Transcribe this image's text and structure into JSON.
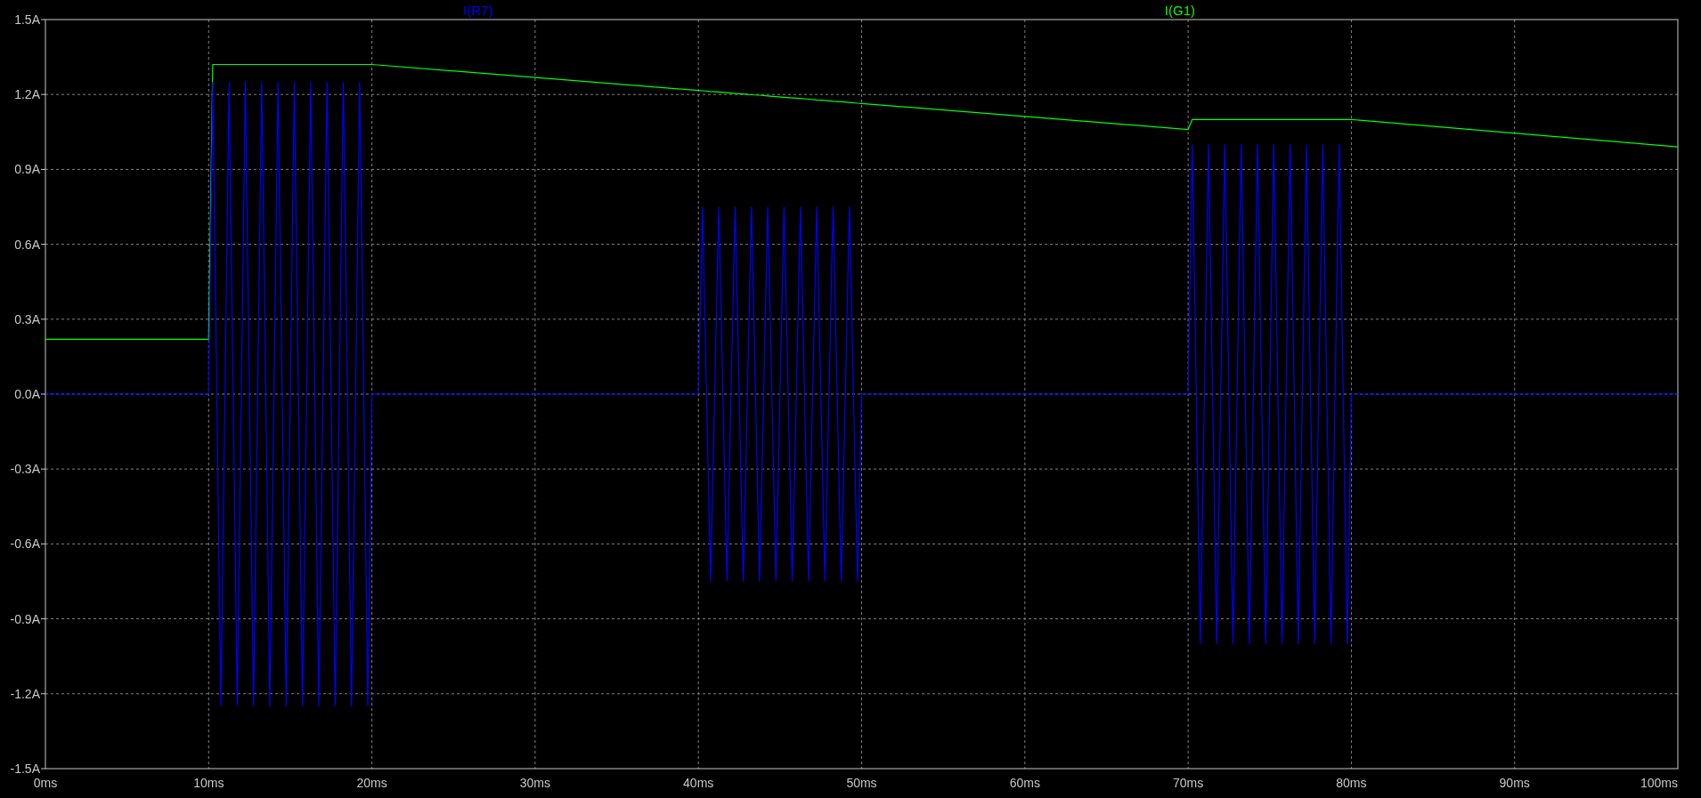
{
  "plot": {
    "chart_data": {
      "type": "line",
      "x": [
        0,
        10,
        10.25,
        10.75,
        11.25,
        11.75,
        12.25,
        12.75,
        13.25,
        13.75,
        14.25,
        14.75,
        15.25,
        15.75,
        16.25,
        16.75,
        17.25,
        17.75,
        18.25,
        18.75,
        19.25,
        19.75,
        20,
        40,
        40.25,
        40.75,
        41.25,
        41.75,
        42.25,
        42.75,
        43.25,
        43.75,
        44.25,
        44.75,
        45.25,
        45.75,
        46.25,
        46.75,
        47.25,
        47.75,
        48.25,
        48.75,
        49.25,
        49.75,
        50,
        70,
        70.25,
        70.75,
        71.25,
        71.75,
        72.25,
        72.75,
        73.25,
        73.75,
        74.25,
        74.75,
        75.25,
        75.75,
        76.25,
        76.75,
        77.25,
        77.75,
        78.25,
        78.75,
        79.25,
        79.75,
        80,
        100
      ],
      "series": [
        {
          "name": "I(R7)",
          "color": "#0000ff",
          "values": [
            0,
            0,
            1.25,
            -1.25,
            1.25,
            -1.25,
            1.25,
            -1.25,
            1.25,
            -1.25,
            1.25,
            -1.25,
            1.25,
            -1.25,
            1.25,
            -1.25,
            1.25,
            -1.25,
            1.25,
            -1.25,
            1.25,
            -1.25,
            0,
            0,
            0.75,
            -0.75,
            0.75,
            -0.75,
            0.75,
            -0.75,
            0.75,
            -0.75,
            0.75,
            -0.75,
            0.75,
            -0.75,
            0.75,
            -0.75,
            0.75,
            -0.75,
            0.75,
            -0.75,
            0.75,
            -0.75,
            0,
            0,
            1,
            -1,
            1,
            -1,
            1,
            -1,
            1,
            -1,
            1,
            -1,
            1,
            -1,
            1,
            -1,
            1,
            -1,
            1,
            -1,
            1,
            -1,
            0,
            0
          ]
        },
        {
          "name": "I(G1)",
          "color": "#00ff00",
          "values": [
            0.22,
            0.22,
            1.32,
            1.32,
            1.32,
            1.32,
            1.32,
            1.32,
            1.32,
            1.32,
            1.32,
            1.32,
            1.32,
            1.32,
            1.32,
            1.32,
            1.32,
            1.32,
            1.32,
            1.32,
            1.32,
            1.32,
            1.32,
            1.216,
            1.215,
            1.212,
            1.21,
            1.207,
            1.204,
            1.202,
            1.199,
            1.197,
            1.194,
            1.191,
            1.189,
            1.186,
            1.184,
            1.181,
            1.178,
            1.176,
            1.173,
            1.171,
            1.168,
            1.165,
            1.164,
            1.06,
            1.1,
            1.1,
            1.1,
            1.1,
            1.1,
            1.1,
            1.1,
            1.1,
            1.1,
            1.1,
            1.1,
            1.1,
            1.1,
            1.1,
            1.1,
            1.1,
            1.1,
            1.1,
            1.1,
            1.1,
            1.1,
            0.99
          ]
        }
      ],
      "grid": true,
      "xlim": [
        0,
        100
      ],
      "ylim": [
        -1.5,
        1.5
      ],
      "xticks": [
        {
          "value": 0,
          "label": "0ms"
        },
        {
          "value": 10,
          "label": "10ms"
        },
        {
          "value": 20,
          "label": "20ms"
        },
        {
          "value": 30,
          "label": "30ms"
        },
        {
          "value": 40,
          "label": "40ms"
        },
        {
          "value": 50,
          "label": "50ms"
        },
        {
          "value": 60,
          "label": "60ms"
        },
        {
          "value": 70,
          "label": "70ms"
        },
        {
          "value": 80,
          "label": "80ms"
        },
        {
          "value": 90,
          "label": "90ms"
        },
        {
          "value": 100,
          "label": "100ms"
        }
      ],
      "yticks": [
        {
          "value": 1.5,
          "label": "1.5A"
        },
        {
          "value": 1.2,
          "label": "1.2A"
        },
        {
          "value": 0.9,
          "label": "0.9A"
        },
        {
          "value": 0.6,
          "label": "0.6A"
        },
        {
          "value": 0.3,
          "label": "0.3A"
        },
        {
          "value": 0,
          "label": "0.0A"
        },
        {
          "value": -0.3,
          "label": "-0.3A"
        },
        {
          "value": -0.6,
          "label": "-0.6A"
        },
        {
          "value": -0.9,
          "label": "-0.9A"
        },
        {
          "value": -1.2,
          "label": "-1.2A"
        },
        {
          "value": -1.5,
          "label": "-1.5A"
        }
      ]
    }
  }
}
